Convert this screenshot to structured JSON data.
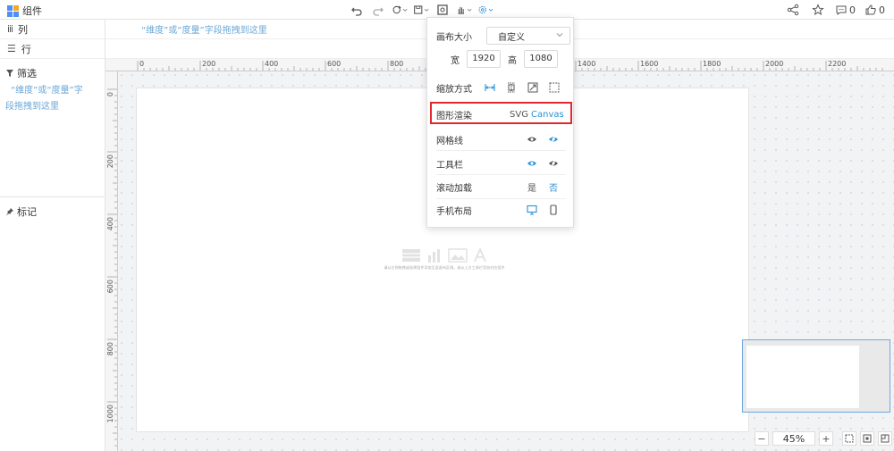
{
  "topbar": {
    "brand_label": "组件",
    "logo_colors": [
      "#4f8ff7",
      "#f5a623",
      "#4f8ff7",
      "#4f8ff7"
    ],
    "center_icons": [
      "undo-icon",
      "redo-icon",
      "refresh-icon",
      "save-icon",
      "preview-icon",
      "pan-hand-icon",
      "settings-icon"
    ],
    "share_icon": "share-icon",
    "star_icon": "star-icon",
    "comment_count": "0",
    "like_count": "0"
  },
  "left_panel": {
    "column_label": "列",
    "row_label": "行",
    "filter_label": "筛选",
    "filter_hint_line1": "“维度”或“度量”字",
    "filter_hint_line2": "段拖拽到这里",
    "mark_label": "标记"
  },
  "field_hint": "“维度”或“度量”字段拖拽到这里",
  "ruler": {
    "h_labels": [
      "0",
      "200",
      "400",
      "600",
      "800",
      "1000",
      "1200",
      "1400",
      "1600",
      "1800",
      "2000",
      "2200"
    ],
    "v_labels": [
      "0",
      "200",
      "400",
      "600",
      "800",
      "1000"
    ]
  },
  "placeholder": {
    "text": "请从左侧拖拽或选择组件添加至此画布区域，或从上方工具栏添加对应组件"
  },
  "zoom": {
    "minus": "−",
    "value": "45%",
    "plus": "+"
  },
  "settings_popover": {
    "canvas_size_label": "画布大小",
    "canvas_size_value": "自定义",
    "width_label": "宽",
    "width_value": "1920",
    "height_label": "高",
    "height_value": "1080",
    "scale_mode_label": "缩放方式",
    "render_label": "图形渲染",
    "render_svg": "SVG",
    "render_canvas": "Canvas",
    "gridline_label": "网格线",
    "toolbar_label": "工具栏",
    "scroll_load_label": "滚动加载",
    "scroll_yes": "是",
    "scroll_no": "否",
    "mobile_layout_label": "手机布局"
  },
  "colors": {
    "accent": "#2a8fd8",
    "hint": "#6ba7d6",
    "highlight": "#e0282e"
  }
}
